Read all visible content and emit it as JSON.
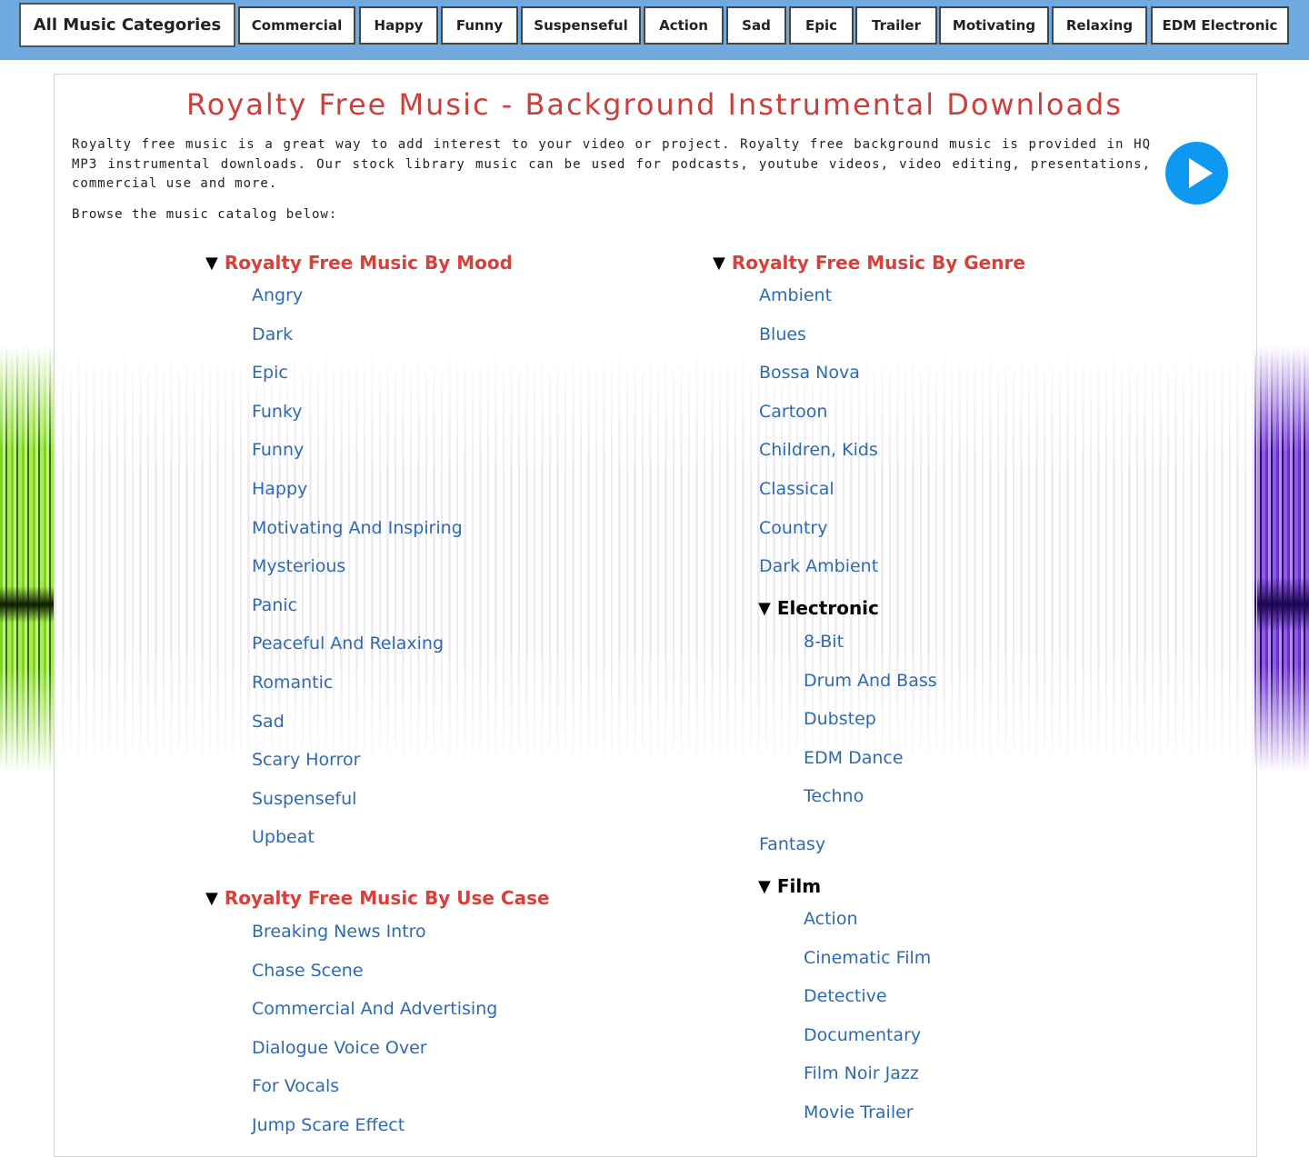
{
  "nav": {
    "main": "All Music Categories",
    "buttons": [
      "Commercial",
      "Happy",
      "Funny",
      "Suspenseful",
      "Action",
      "Sad",
      "Epic",
      "Trailer",
      "Motivating",
      "Relaxing",
      "EDM Electronic"
    ]
  },
  "page": {
    "title": "Royalty Free Music - Background Instrumental Downloads",
    "intro": "Royalty free music is a great way to add interest to your video or project. Royalty free background music is provided in HQ MP3 instrumental downloads. Our stock library music can be used for podcasts, youtube videos, video editing, presentations, commercial use and more.",
    "browse": "Browse the music catalog below:"
  },
  "mood": {
    "heading": "Royalty Free Music By Mood",
    "items": [
      "Angry",
      "Dark",
      "Epic",
      "Funky",
      "Funny",
      "Happy",
      "Motivating And Inspiring",
      "Mysterious",
      "Panic",
      "Peaceful And Relaxing",
      "Romantic",
      "Sad",
      "Scary Horror",
      "Suspenseful",
      "Upbeat"
    ]
  },
  "usecase": {
    "heading": "Royalty Free Music By Use Case",
    "items": [
      "Breaking News Intro",
      "Chase Scene",
      "Commercial And Advertising",
      "Dialogue Voice Over",
      "For Vocals",
      "Jump Scare Effect"
    ]
  },
  "genre": {
    "heading": "Royalty Free Music By Genre",
    "items_top": [
      "Ambient",
      "Blues",
      "Bossa Nova",
      "Cartoon",
      "Children, Kids",
      "Classical",
      "Country",
      "Dark Ambient"
    ],
    "electronic": {
      "heading": "Electronic",
      "items": [
        "8-Bit",
        "Drum And Bass",
        "Dubstep",
        "EDM Dance",
        "Techno"
      ]
    },
    "fantasy": "Fantasy",
    "film": {
      "heading": "Film",
      "items": [
        "Action",
        "Cinematic Film",
        "Detective",
        "Documentary",
        "Film Noir Jazz",
        "Movie Trailer"
      ]
    }
  },
  "icons": {
    "triangle": "▼",
    "play": "play-icon"
  },
  "colors": {
    "nav_bg": "#6fa9dd",
    "heading_red": "#d9403a",
    "link_blue": "#2e6ab3",
    "play_blue": "#0d99f2"
  }
}
